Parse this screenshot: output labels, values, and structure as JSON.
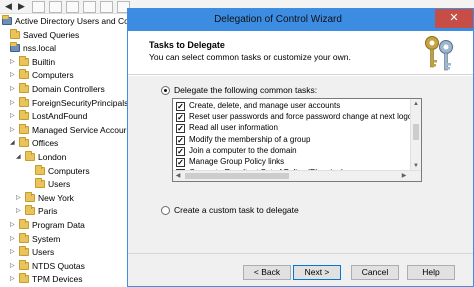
{
  "console": {
    "tree": [
      {
        "label": "Active Directory Users and Com",
        "level": 0,
        "icon": "ad-console-icon"
      },
      {
        "label": "Saved Queries",
        "level": 1,
        "icon": "folder-icon"
      },
      {
        "label": "nss.local",
        "level": 1,
        "icon": "domain-icon",
        "expanded": true
      },
      {
        "label": "Builtin",
        "level": 2,
        "icon": "folder-icon"
      },
      {
        "label": "Computers",
        "level": 2,
        "icon": "folder-icon"
      },
      {
        "label": "Domain Controllers",
        "level": 2,
        "icon": "folder-icon"
      },
      {
        "label": "ForeignSecurityPrincipals",
        "level": 2,
        "icon": "folder-icon"
      },
      {
        "label": "LostAndFound",
        "level": 2,
        "icon": "folder-icon"
      },
      {
        "label": "Managed Service Accour",
        "level": 2,
        "icon": "folder-icon"
      },
      {
        "label": "Offices",
        "level": 2,
        "icon": "folder-icon",
        "expanded": true
      },
      {
        "label": "London",
        "level": 3,
        "icon": "folder-icon",
        "expanded": true
      },
      {
        "label": "Computers",
        "level": 4,
        "icon": "folder-icon"
      },
      {
        "label": "Users",
        "level": 4,
        "icon": "folder-icon"
      },
      {
        "label": "New York",
        "level": 3,
        "icon": "folder-icon"
      },
      {
        "label": "Paris",
        "level": 3,
        "icon": "folder-icon"
      },
      {
        "label": "Program Data",
        "level": 2,
        "icon": "folder-icon"
      },
      {
        "label": "System",
        "level": 2,
        "icon": "folder-icon"
      },
      {
        "label": "Users",
        "level": 2,
        "icon": "folder-icon"
      },
      {
        "label": "NTDS Quotas",
        "level": 2,
        "icon": "folder-icon"
      },
      {
        "label": "TPM Devices",
        "level": 2,
        "icon": "folder-icon"
      }
    ]
  },
  "wizard": {
    "title": "Delegation of Control Wizard",
    "close_label": "✕",
    "header_title": "Tasks to Delegate",
    "header_subtitle": "You can select common tasks or customize your own.",
    "option_common": "Delegate the following common tasks:",
    "option_custom": "Create a custom task to delegate",
    "selected_option": "common",
    "tasks": [
      {
        "label": "Create, delete, and manage user accounts",
        "checked": true
      },
      {
        "label": "Reset user passwords and force password change at next logon",
        "checked": true
      },
      {
        "label": "Read all user information",
        "checked": true
      },
      {
        "label": "Modify the membership of a group",
        "checked": true
      },
      {
        "label": "Join a computer to the domain",
        "checked": true
      },
      {
        "label": "Manage Group Policy links",
        "checked": true
      },
      {
        "label": "Generate Resultant Set of Policy (Planning)",
        "checked": true
      }
    ],
    "buttons": {
      "back": "< Back",
      "next": "Next >",
      "cancel": "Cancel",
      "help": "Help"
    }
  },
  "colors": {
    "titlebar": "#3c8de2",
    "close": "#c64e46",
    "folder": "#e9c45b"
  }
}
